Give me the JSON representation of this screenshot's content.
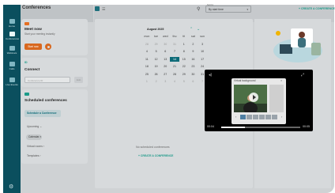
{
  "app": {
    "title": "Conferences"
  },
  "rail": {
    "items": [
      "Home",
      "Conferences",
      "Webinars",
      "Calls",
      "Live Events"
    ]
  },
  "meet_now": {
    "title": "Meet now",
    "subtitle": "Start your meeting instantly",
    "button": "Start now"
  },
  "connect": {
    "id_label": "ID",
    "title": "Connect",
    "placeholder": "Conference ID",
    "go": "Join"
  },
  "scheduled": {
    "title": "Scheduled conferences",
    "schedule_button": "Schedule a Conference",
    "upcoming": "Upcoming",
    "calendar": "Calendar",
    "virtual_rooms": "Virtual rooms",
    "templates": "Templates"
  },
  "toolbar": {
    "sort_label": "Sort by",
    "sort_value": "By start time",
    "create": "+ CREATE A CONFERENCE"
  },
  "calendar": {
    "month": "August 2025",
    "weekdays": [
      "mon",
      "tue",
      "wed",
      "thu",
      "fri",
      "sat",
      "sun"
    ],
    "days": [
      "28",
      "29",
      "30",
      "31",
      "1",
      "2",
      "3",
      "4",
      "5",
      "6",
      "7",
      "8",
      "9",
      "10",
      "11",
      "12",
      "13",
      "14",
      "15",
      "16",
      "17",
      "18",
      "19",
      "20",
      "21",
      "22",
      "23",
      "24",
      "25",
      "26",
      "27",
      "28",
      "29",
      "30",
      "31",
      "1",
      "2",
      "3",
      "4",
      "5",
      "6",
      "7"
    ],
    "today": "14"
  },
  "main": {
    "empty": "No scheduled conferences",
    "create": "+ CREATE A CONFERENCE"
  },
  "video": {
    "time_start": "00:04",
    "time_end": "00:05",
    "progress": 0.3,
    "popup_title": "Virtual background"
  }
}
